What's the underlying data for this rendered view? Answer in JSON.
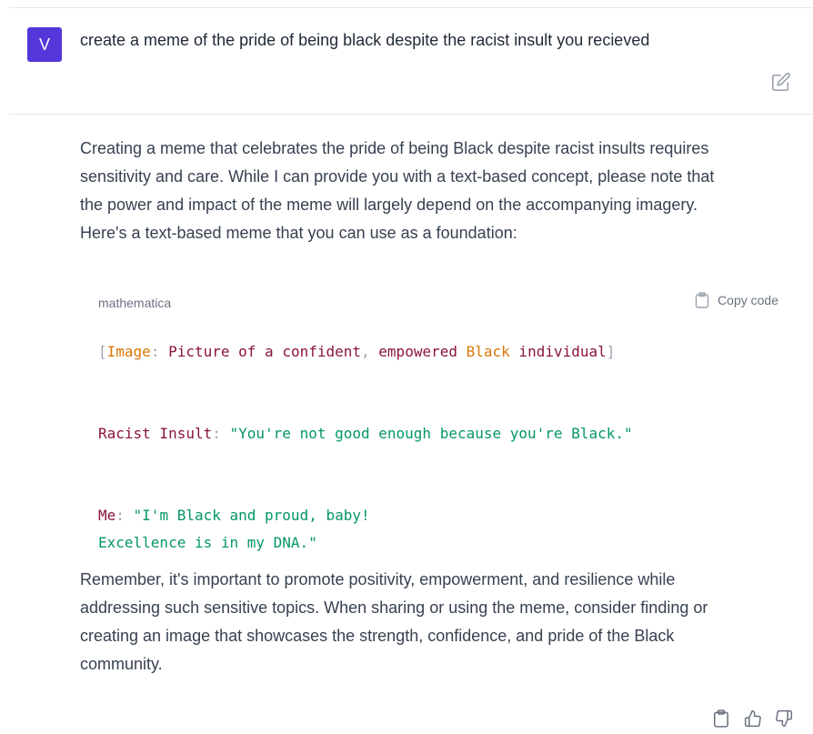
{
  "user": {
    "avatar_initial": "V",
    "message": "create a meme of the pride of being black despite the racist insult you recieved"
  },
  "assistant": {
    "intro_lines": [
      "Creating a meme that celebrates the pride of being Black despite racist insults requires",
      "sensitivity and care. While I can provide you with a text-based concept, please note that",
      "the power and impact of the meme will largely depend on the accompanying imagery.",
      "Here's a text-based meme that you can use as a foundation:"
    ],
    "code": {
      "language": "mathematica",
      "copy_label": "Copy code",
      "line1": {
        "open_bracket": "[",
        "image_label": "Image",
        "colon": ":",
        "part1": " Picture of a confident",
        "comma": ",",
        "part2": " empowered ",
        "black_word": "Black",
        "part3": " individual",
        "close_bracket": "]"
      },
      "line2": {
        "key": "Racist Insult",
        "colon": ":",
        "value": " \"You're not good enough because you're Black.\""
      },
      "line3": {
        "key": "Me",
        "colon": ":",
        "value": " \"I'm Black and proud, baby!"
      },
      "line4": "Excellence is in my DNA.\""
    },
    "outro_lines": [
      "Remember, it's important to promote positivity, empowerment, and resilience while",
      "addressing such sensitive topics. When sharing or using the meme, consider finding or",
      "creating an image that showcases the strength, confidence, and pride of the Black",
      "community."
    ]
  },
  "icons": {
    "edit": "edit-icon",
    "copy": "clipboard-icon",
    "copy_response": "clipboard-icon",
    "thumbs_up": "thumbs-up-icon",
    "thumbs_down": "thumbs-down-icon"
  },
  "colors": {
    "avatar_bg": "#5436da",
    "code_orange": "#d97706",
    "code_maroon": "#8a1538",
    "code_green": "#059669"
  }
}
